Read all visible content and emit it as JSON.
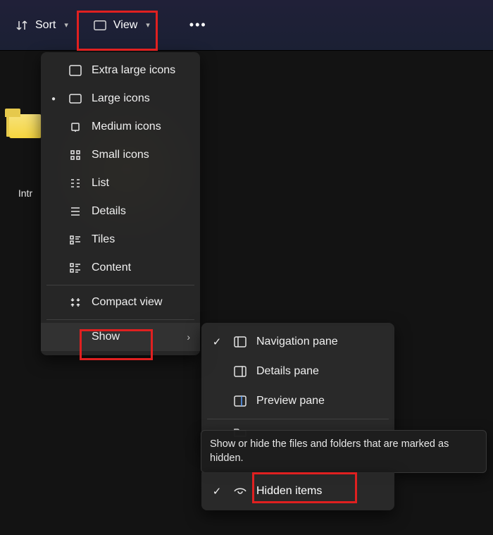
{
  "toolbar": {
    "sort_label": "Sort",
    "view_label": "View"
  },
  "folder": {
    "label": "Intr"
  },
  "view_menu": {
    "items": [
      {
        "label": "Extra large icons",
        "selected": false
      },
      {
        "label": "Large icons",
        "selected": true
      },
      {
        "label": "Medium icons",
        "selected": false
      },
      {
        "label": "Small icons",
        "selected": false
      },
      {
        "label": "List",
        "selected": false
      },
      {
        "label": "Details",
        "selected": false
      },
      {
        "label": "Tiles",
        "selected": false
      },
      {
        "label": "Content",
        "selected": false
      }
    ],
    "compact_label": "Compact view",
    "show_label": "Show"
  },
  "show_submenu": {
    "items": [
      {
        "label": "Navigation pane",
        "checked": true
      },
      {
        "label": "Details pane",
        "checked": false
      },
      {
        "label": "Preview pane",
        "checked": false
      }
    ],
    "hidden_label": "Hidden items",
    "hidden_checked": true
  },
  "tooltip": {
    "text": "Show or hide the files and folders that are marked as hidden."
  }
}
